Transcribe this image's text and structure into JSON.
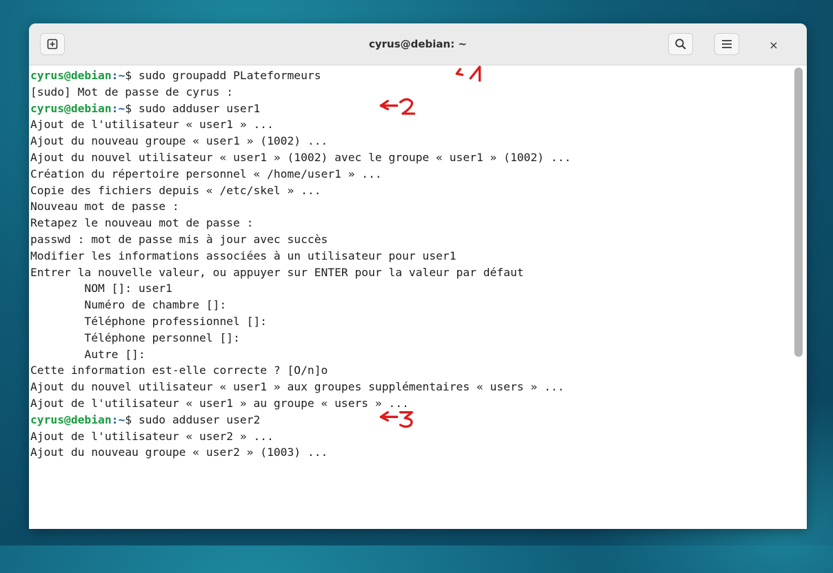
{
  "window": {
    "title": "cyrus@debian: ~",
    "close_label": "×"
  },
  "terminal": {
    "prompt_user": "cyrus@debian",
    "prompt_path": ":~",
    "lines": [
      {
        "type": "cmd",
        "text": "$ sudo groupadd PLateformeurs",
        "annotation": "1"
      },
      {
        "type": "out",
        "text": "[sudo] Mot de passe de cyrus :"
      },
      {
        "type": "cmd",
        "text": "$ sudo adduser user1",
        "annotation": "2"
      },
      {
        "type": "out",
        "text": "Ajout de l'utilisateur « user1 » ..."
      },
      {
        "type": "out",
        "text": "Ajout du nouveau groupe « user1 » (1002) ..."
      },
      {
        "type": "out",
        "text": "Ajout du nouvel utilisateur « user1 » (1002) avec le groupe « user1 » (1002) ..."
      },
      {
        "type": "out",
        "text": "Création du répertoire personnel « /home/user1 » ..."
      },
      {
        "type": "out",
        "text": "Copie des fichiers depuis « /etc/skel » ..."
      },
      {
        "type": "out",
        "text": "Nouveau mot de passe :"
      },
      {
        "type": "out",
        "text": "Retapez le nouveau mot de passe :"
      },
      {
        "type": "out",
        "text": "passwd : mot de passe mis à jour avec succès"
      },
      {
        "type": "out",
        "text": "Modifier les informations associées à un utilisateur pour user1"
      },
      {
        "type": "out",
        "text": "Entrer la nouvelle valeur, ou appuyer sur ENTER pour la valeur par défaut"
      },
      {
        "type": "out",
        "text": "        NOM []: user1"
      },
      {
        "type": "out",
        "text": "        Numéro de chambre []:"
      },
      {
        "type": "out",
        "text": "        Téléphone professionnel []:"
      },
      {
        "type": "out",
        "text": "        Téléphone personnel []:"
      },
      {
        "type": "out",
        "text": "        Autre []:"
      },
      {
        "type": "out",
        "text": "Cette information est-elle correcte ? [O/n]o"
      },
      {
        "type": "out",
        "text": "Ajout du nouvel utilisateur « user1 » aux groupes supplémentaires « users » ..."
      },
      {
        "type": "out",
        "text": "Ajout de l'utilisateur « user1 » au groupe « users » ..."
      },
      {
        "type": "cmd",
        "text": "$ sudo adduser user2",
        "annotation": "3"
      },
      {
        "type": "out",
        "text": "Ajout de l'utilisateur « user2 » ..."
      },
      {
        "type": "out",
        "text": "Ajout du nouveau groupe « user2 » (1003) ..."
      }
    ]
  },
  "colors": {
    "prompt_user": "#1a9a40",
    "prompt_path": "#1b5fae",
    "annotation": "#e01a1a"
  },
  "icons": {
    "new_tab": "new-tab-icon",
    "search": "search-icon",
    "menu": "hamburger-menu-icon",
    "close": "close-icon"
  }
}
